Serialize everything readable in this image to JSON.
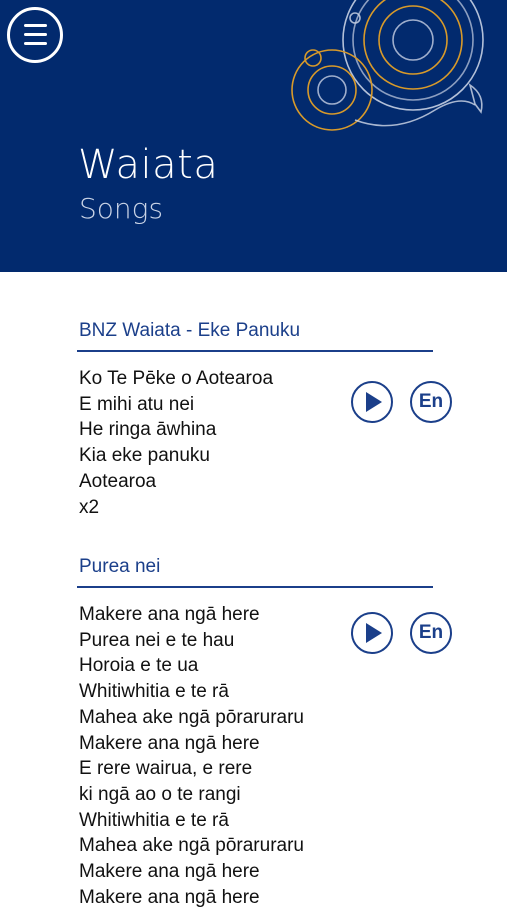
{
  "header": {
    "title": "Waiata",
    "subtitle": "Songs",
    "menu_icon": "hamburger-menu-icon",
    "background_color": "#022a6e",
    "decor_colors": [
      "#d89a2a",
      "#c7d0e3"
    ]
  },
  "songs": [
    {
      "title": "BNZ Waiata - Eke Panuku",
      "play_icon": "play-icon",
      "translate_label": "En",
      "lyrics": [
        "Ko Te Pēke o Aotearoa",
        "E mihi atu nei",
        "He ringa āwhina",
        "Kia eke panuku",
        "Aotearoa",
        "x2"
      ]
    },
    {
      "title": "Purea nei",
      "play_icon": "play-icon",
      "translate_label": "En",
      "lyrics": [
        "Makere ana ngā here",
        "Purea nei e te hau",
        "Horoia e te ua",
        "Whitiwhitia e te rā",
        "Mahea ake ngā pōraruraru",
        "Makere ana ngā here",
        "E rere wairua, e rere",
        "ki ngā ao o te rangi",
        "Whitiwhitia e te rā",
        "Mahea ake ngā pōraruraru",
        "Makere ana ngā here",
        "Makere ana ngā here"
      ]
    }
  ],
  "accent_color": "#1b3f8a"
}
